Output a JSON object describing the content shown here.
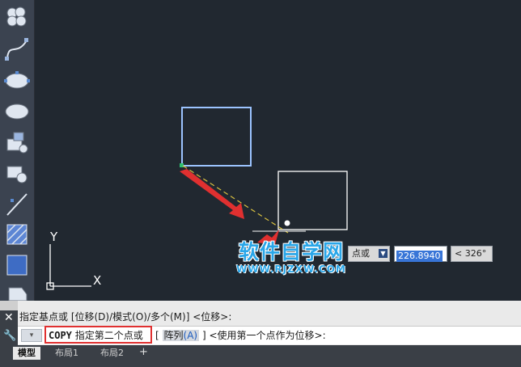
{
  "toolbar": {
    "tools": [
      {
        "name": "revcloud-tool-icon"
      },
      {
        "name": "spline-tool-icon"
      },
      {
        "name": "ellipse-tool-icon"
      },
      {
        "name": "ellipse-arc-tool-icon"
      },
      {
        "name": "insert-block-tool-icon"
      },
      {
        "name": "make-block-tool-icon"
      },
      {
        "name": "point-tool-icon"
      },
      {
        "name": "hatch-tool-icon"
      },
      {
        "name": "gradient-tool-icon"
      },
      {
        "name": "region-tool-icon"
      }
    ]
  },
  "canvas": {
    "ucs_y": "Y",
    "ucs_x": "X",
    "dynamic_input": {
      "prompt_partial": "点或",
      "distance_value": "226.8940",
      "angle_value": "< 326°"
    }
  },
  "watermark": {
    "main": "软件自学网",
    "url": "WWW.RJZXW.COM"
  },
  "command": {
    "history": "指定基点或 [位移(D)/模式(O)/多个(M)] <位移>:",
    "command_name": "COPY",
    "prompt": "指定第二个点或",
    "option_open": "[",
    "option_label": "阵列",
    "option_key": "(A)",
    "option_close": "]",
    "default_text": "<使用第一个点作为位移>:"
  },
  "layout_tabs": [
    "模型",
    "布局1",
    "布局2"
  ],
  "add_tab_symbol": "+",
  "colors": {
    "canvas_bg": "#212830",
    "selected_rect": "#9cc4ff",
    "copy_rect": "#ffffff",
    "rubberband": "#d8c040",
    "arrow": "#e03030",
    "highlight": "#e03030"
  }
}
